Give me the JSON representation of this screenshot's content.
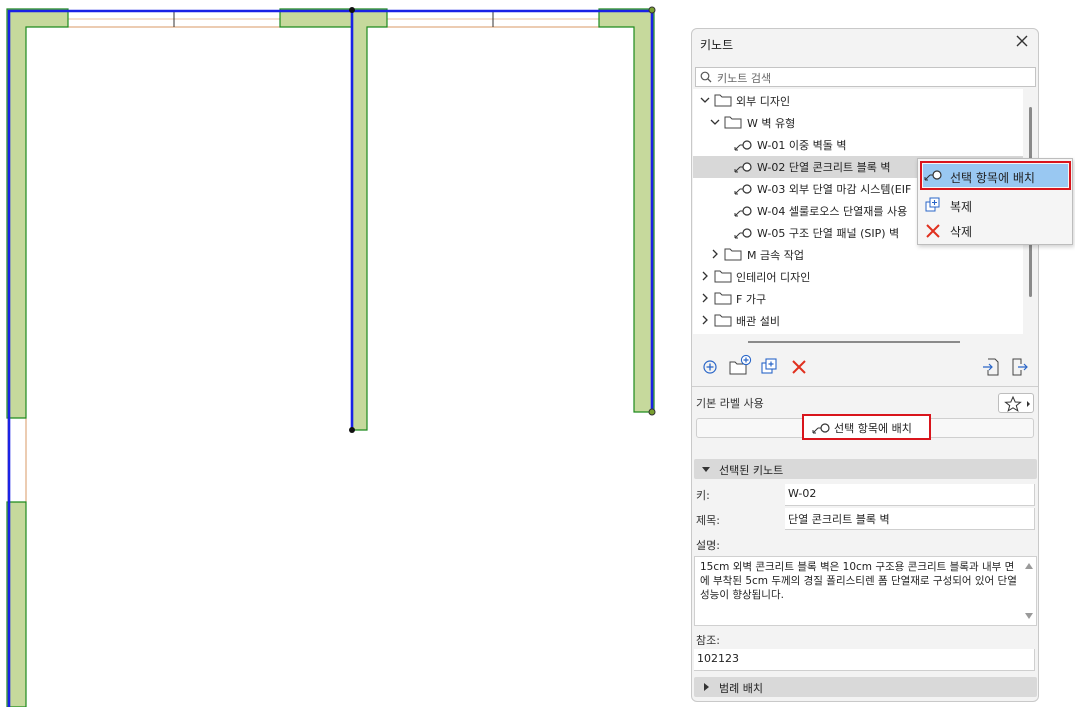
{
  "panel": {
    "title": "키노트",
    "search_placeholder": "키노트 검색",
    "tree": [
      {
        "label": "외부 디자인",
        "level": 0,
        "type": "folder",
        "expanded": true
      },
      {
        "label": "W 벽 유형",
        "level": 1,
        "type": "folder",
        "expanded": true
      },
      {
        "label": "W-01 이중 벽돌 벽",
        "level": 2,
        "type": "keynote"
      },
      {
        "label": "W-02 단열 콘크리트 블록 벽",
        "level": 2,
        "type": "keynote",
        "selected": true
      },
      {
        "label": "W-03 외부 단열 마감 시스템(EIF",
        "level": 2,
        "type": "keynote"
      },
      {
        "label": "W-04 셀룰로오스 단열재를 사용",
        "level": 2,
        "type": "keynote"
      },
      {
        "label": "W-05 구조 단열 패널 (SIP) 벽",
        "level": 2,
        "type": "keynote"
      },
      {
        "label": "M 금속 작업",
        "level": 1,
        "type": "folder",
        "expanded": false
      },
      {
        "label": "인테리어 디자인",
        "level": 0,
        "type": "folder",
        "expanded": false
      },
      {
        "label": "F 가구",
        "level": 0,
        "type": "folder",
        "expanded": false
      },
      {
        "label": "배관 설비",
        "level": 0,
        "type": "folder",
        "expanded": false
      }
    ],
    "default_label_text": "기본 라벨 사용",
    "place_button": "선택 항목에 배치",
    "selected_section": "선택된 키노트",
    "key_label": "키:",
    "key_value": "W-02",
    "title_label": "제목:",
    "title_value": "단열 콘크리트 블록 벽",
    "desc_label": "설명:",
    "desc_value": "15cm 외벽 콘크리트 블록 벽은 10cm 구조용 콘크리트 블록과 내부 면에 부착된 5cm 두께의 경질 폴리스티렌 폼 단열재로 구성되어 있어 단열 성능이 향상됩니다.",
    "ref_label": "참조:",
    "ref_value": "102123",
    "legend_section": "범례 배치"
  },
  "context_menu": {
    "items": [
      "선택 항목에 배치",
      "복제",
      "삭제"
    ]
  },
  "colors": {
    "wall_fill": "#c6d99c",
    "wall_outline": "#1d8a1d",
    "selection_blue": "#1a22e6",
    "highlight_red": "#d9151c",
    "menu_highlight": "#99c8f2"
  }
}
